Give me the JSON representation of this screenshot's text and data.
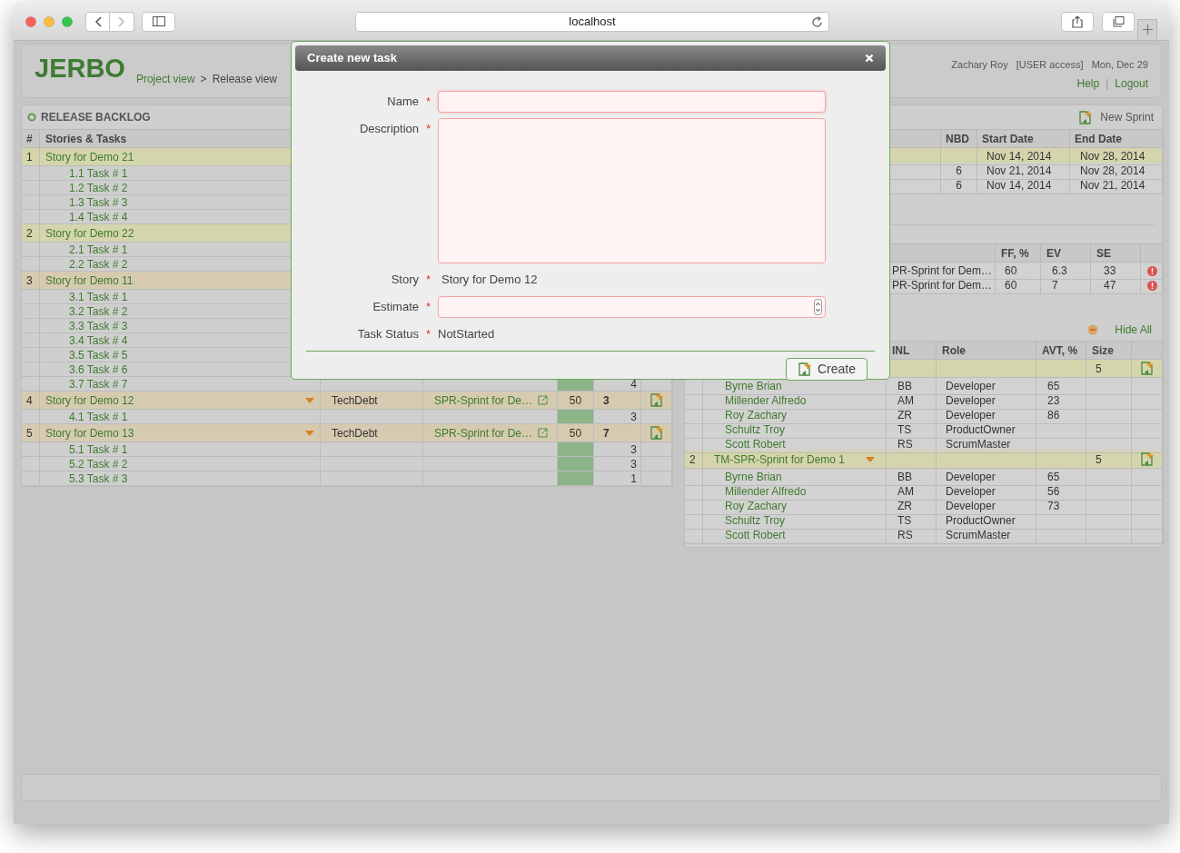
{
  "browser": {
    "address": "localhost"
  },
  "header": {
    "logo": "JERBO",
    "breadcrumbs": [
      "Project view",
      "Release view"
    ],
    "separator": ">",
    "user": "Zachary Roy",
    "access": "[USER access]",
    "date": "Mon, Dec 29",
    "links": [
      "Help",
      "Logout"
    ],
    "link_separator": "|"
  },
  "backlog": {
    "title": "RELEASE BACKLOG",
    "columns": [
      "#",
      "Stories & Tasks"
    ],
    "rows": [
      {
        "kind": "story",
        "number": "1",
        "name": "Story for Demo 21",
        "color": "#d5d5ad"
      },
      {
        "kind": "task",
        "name": "1.1 Task # 1"
      },
      {
        "kind": "task",
        "name": "1.2 Task # 2"
      },
      {
        "kind": "task",
        "name": "1.3 Task # 3"
      },
      {
        "kind": "task",
        "name": "1.4 Task # 4"
      },
      {
        "kind": "story",
        "number": "2",
        "name": "Story for Demo 22",
        "color": "#d5d5ad"
      },
      {
        "kind": "task",
        "name": "2.1 Task # 1"
      },
      {
        "kind": "task",
        "name": "2.2 Task # 2"
      },
      {
        "kind": "story",
        "number": "3",
        "name": "Story for Demo 11",
        "color": "#d6cbb0"
      },
      {
        "kind": "task",
        "name": "3.1 Task # 1"
      },
      {
        "kind": "task",
        "name": "3.2 Task # 2"
      },
      {
        "kind": "task",
        "name": "3.3 Task # 3"
      },
      {
        "kind": "task",
        "name": "3.4 Task # 4"
      },
      {
        "kind": "task",
        "name": "3.5 Task # 5"
      },
      {
        "kind": "task",
        "name": "3.6 Task # 6"
      },
      {
        "kind": "task",
        "name": "3.7 Task # 7",
        "estimate": "4"
      },
      {
        "kind": "story",
        "number": "4",
        "name": "Story for Demo 12",
        "color": "#d6cbb0",
        "type": "TechDebt",
        "sprint": "SPR-Sprint for De…",
        "value": "50",
        "estimate": "3"
      },
      {
        "kind": "task",
        "name": "4.1 Task # 1",
        "estimate": "3"
      },
      {
        "kind": "story",
        "number": "5",
        "name": "Story for Demo 13",
        "color": "#d6cbb0",
        "type": "TechDebt",
        "sprint": "SPR-Sprint for De…",
        "value": "50",
        "estimate": "7"
      },
      {
        "kind": "task",
        "name": "5.1 Task # 1",
        "estimate": "3"
      },
      {
        "kind": "task",
        "name": "5.2 Task # 2",
        "estimate": "3"
      },
      {
        "kind": "task",
        "name": "5.3 Task # 3",
        "estimate": "1"
      }
    ]
  },
  "sprints": {
    "new_sprint": "New Sprint",
    "columns": [
      "NBD",
      "Start Date",
      "End Date"
    ],
    "rows": [
      {
        "start": "Nov 14, 2014",
        "end": "Nov 28, 2014",
        "selected": true
      },
      {
        "nbd": "6",
        "start": "Nov 21, 2014",
        "end": "Nov 28, 2014",
        "selected": false
      },
      {
        "nbd": "6",
        "start": "Nov 14, 2014",
        "end": "Nov 21, 2014",
        "selected": false
      }
    ]
  },
  "metrics": {
    "columns": [
      "FF, %",
      "EV",
      "SE"
    ],
    "rows": [
      {
        "sprint": "PR-Sprint for Dem…",
        "ff": "60",
        "ev": "6.3",
        "se": "33"
      },
      {
        "sprint": "PR-Sprint for Dem…",
        "ff": "60",
        "ev": "7",
        "se": "47"
      }
    ]
  },
  "teams": {
    "hide_all": "Hide All",
    "columns": [
      "INL",
      "Role",
      "AVT, %",
      "Size"
    ],
    "groups": [
      {
        "size": "5",
        "members": [
          {
            "name": "Byrne Brian",
            "initials": "BB",
            "role": "Developer",
            "avt": "65"
          },
          {
            "name": "Millender Alfredo",
            "initials": "AM",
            "role": "Developer",
            "avt": "23"
          },
          {
            "name": "Roy Zachary",
            "initials": "ZR",
            "role": "Developer",
            "avt": "86"
          },
          {
            "name": "Schultz Troy",
            "initials": "TS",
            "role": "ProductOwner"
          },
          {
            "name": "Scott Robert",
            "initials": "RS",
            "role": "ScrumMaster"
          }
        ]
      },
      {
        "number": "2",
        "name": "TM-SPR-Sprint for Demo 1",
        "size": "5",
        "members": [
          {
            "name": "Byrne Brian",
            "initials": "BB",
            "role": "Developer",
            "avt": "65"
          },
          {
            "name": "Millender Alfredo",
            "initials": "AM",
            "role": "Developer",
            "avt": "56"
          },
          {
            "name": "Roy Zachary",
            "initials": "ZR",
            "role": "Developer",
            "avt": "73"
          },
          {
            "name": "Schultz Troy",
            "initials": "TS",
            "role": "ProductOwner"
          },
          {
            "name": "Scott Robert",
            "initials": "RS",
            "role": "ScrumMaster"
          }
        ]
      }
    ]
  },
  "dialog": {
    "title": "Create new task",
    "fields": [
      {
        "label": "Name",
        "required_mark": "*",
        "kind": "text"
      },
      {
        "label": "Description",
        "required_mark": "*",
        "kind": "textarea"
      },
      {
        "label": "Story",
        "required_mark": "*",
        "kind": "static",
        "value": "Story for Demo 12"
      },
      {
        "label": "Estimate",
        "required_mark": "*",
        "kind": "number"
      },
      {
        "label": "Task Status",
        "required_mark": "*",
        "kind": "static",
        "value": "NotStarted"
      }
    ],
    "button": "Create"
  }
}
